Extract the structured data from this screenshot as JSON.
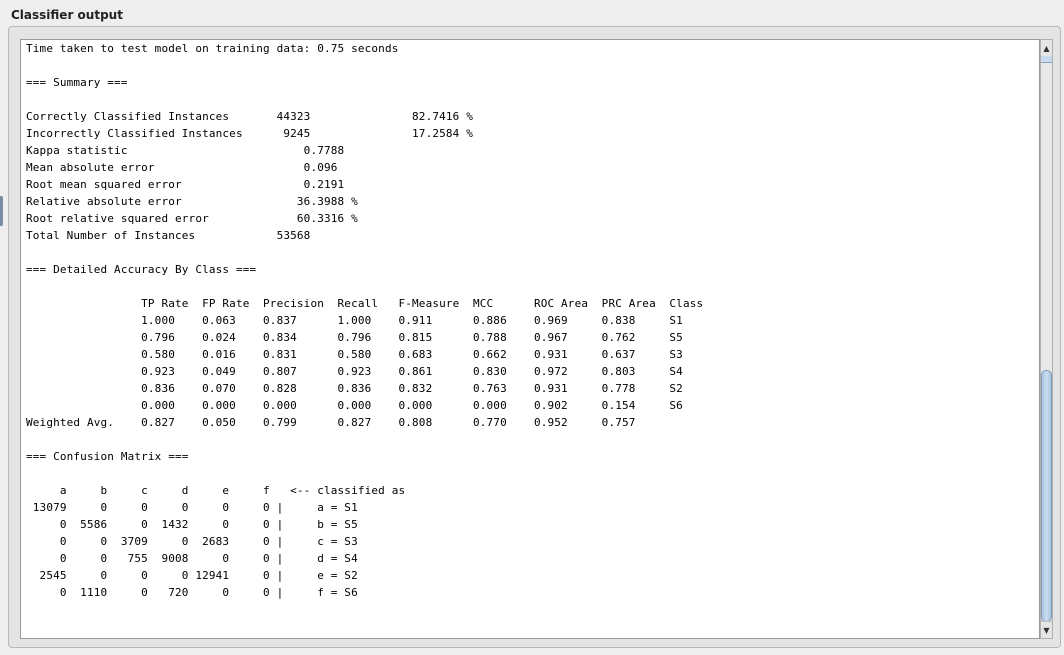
{
  "panel": {
    "title": "Classifier output"
  },
  "output": {
    "lines": [
      "Time taken to test model on training data: 0.75 seconds",
      "",
      "=== Summary ===",
      "",
      "Correctly Classified Instances       44323               82.7416 %",
      "Incorrectly Classified Instances      9245               17.2584 %",
      "Kappa statistic                          0.7788",
      "Mean absolute error                      0.096",
      "Root mean squared error                  0.2191",
      "Relative absolute error                 36.3988 %",
      "Root relative squared error             60.3316 %",
      "Total Number of Instances            53568",
      "",
      "=== Detailed Accuracy By Class ===",
      "",
      "                 TP Rate  FP Rate  Precision  Recall   F-Measure  MCC      ROC Area  PRC Area  Class",
      "                 1.000    0.063    0.837      1.000    0.911      0.886    0.969     0.838     S1",
      "                 0.796    0.024    0.834      0.796    0.815      0.788    0.967     0.762     S5",
      "                 0.580    0.016    0.831      0.580    0.683      0.662    0.931     0.637     S3",
      "                 0.923    0.049    0.807      0.923    0.861      0.830    0.972     0.803     S4",
      "                 0.836    0.070    0.828      0.836    0.832      0.763    0.931     0.778     S2",
      "                 0.000    0.000    0.000      0.000    0.000      0.000    0.902     0.154     S6",
      "Weighted Avg.    0.827    0.050    0.799      0.827    0.808      0.770    0.952     0.757",
      "",
      "=== Confusion Matrix ===",
      "",
      "     a     b     c     d     e     f   <-- classified as",
      " 13079     0     0     0     0     0 |     a = S1",
      "     0  5586     0  1432     0     0 |     b = S5",
      "     0     0  3709     0  2683     0 |     c = S3",
      "     0     0   755  9008     0     0 |     d = S4",
      "  2545     0     0     0 12941     0 |     e = S2",
      "     0  1110     0   720     0     0 |     f = S6"
    ]
  },
  "scrollbar": {
    "up_icon": "triangle-up",
    "down_icon": "triangle-down",
    "position_fraction": 0.95
  }
}
